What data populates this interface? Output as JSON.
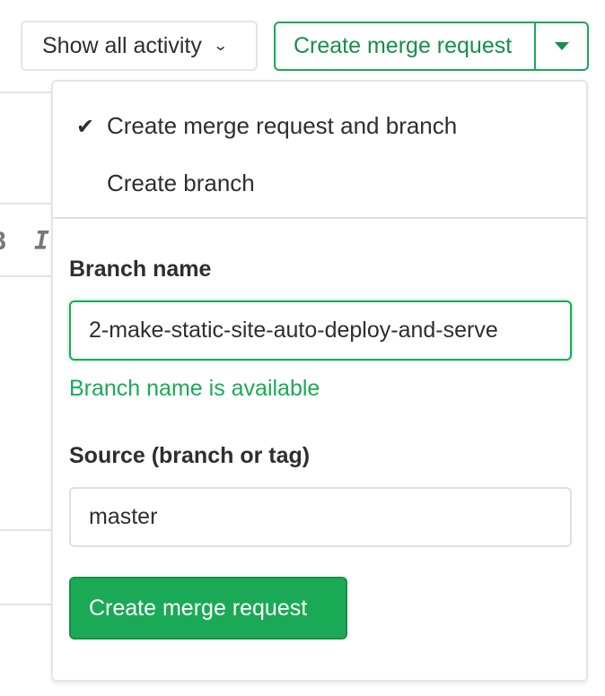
{
  "toolbar": {
    "activity_filter_label": "Show all activity",
    "create_mr_label": "Create merge request"
  },
  "dropdown": {
    "options": [
      {
        "label": "Create merge request and branch",
        "selected": true
      },
      {
        "label": "Create branch",
        "selected": false
      }
    ],
    "branch_name_label": "Branch name",
    "branch_name_value": "2-make-static-site-auto-deploy-and-serve",
    "branch_status": "Branch name is available",
    "source_label": "Source (branch or tag)",
    "source_value": "master",
    "submit_label": "Create merge request"
  },
  "background": {
    "editor_chars": [
      "B",
      "I"
    ]
  },
  "colors": {
    "accent": "#1aaa55",
    "accent_text": "#168f48",
    "border": "#e5e5e5"
  }
}
